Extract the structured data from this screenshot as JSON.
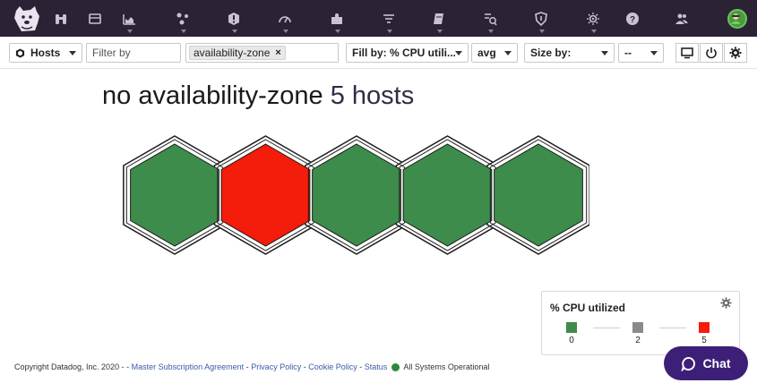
{
  "colors": {
    "nav_bg": "#2b2236",
    "ok_green": "#3e8c4b",
    "alert_red": "#f41c0a",
    "neutral_gray": "#8a8a8a",
    "chat_purple": "#3d1f77"
  },
  "nav": {
    "icons": [
      "dog-logo-icon",
      "binoculars-icon",
      "dashboard-icon",
      "chart-icon",
      "graph-nodes-icon",
      "alert-icon",
      "gauge-icon",
      "puzzle-icon",
      "filter-lines-icon",
      "notebook-icon",
      "logs-icon",
      "shield-icon",
      "processor-icon",
      "help-icon",
      "team-icon",
      "avatar-icon"
    ]
  },
  "toolbar": {
    "hosts_label": "Hosts",
    "filter_placeholder": "Filter by",
    "group_tag": "availability-zone",
    "group_tag_remove": "×",
    "fill_label": "Fill by: % CPU utili...",
    "avg_label": "avg",
    "size_label": "Size by:",
    "size_value": "--"
  },
  "map": {
    "title_prefix": "no availability-zone",
    "title_count": "5 hosts",
    "hosts": [
      {
        "status": "ok"
      },
      {
        "status": "alert"
      },
      {
        "status": "ok"
      },
      {
        "status": "ok"
      },
      {
        "status": "ok"
      }
    ]
  },
  "legend": {
    "title": "% CPU utilized",
    "stops": [
      {
        "label": "0",
        "color": "#3e8c4b"
      },
      {
        "label": "2",
        "color": "#8a8a8a"
      },
      {
        "label": "5",
        "color": "#f41c0a"
      }
    ]
  },
  "footer": {
    "copyright": "Copyright Datadog, Inc. 2020 - -",
    "link_msa": "Master Subscription Agreement",
    "sep1": "-",
    "link_privacy": "Privacy Policy",
    "sep2": "-",
    "link_cookie": "Cookie Policy",
    "sep3": "-",
    "link_status": "Status",
    "status_text": "All Systems Operational"
  },
  "chat": {
    "label": "Chat"
  }
}
